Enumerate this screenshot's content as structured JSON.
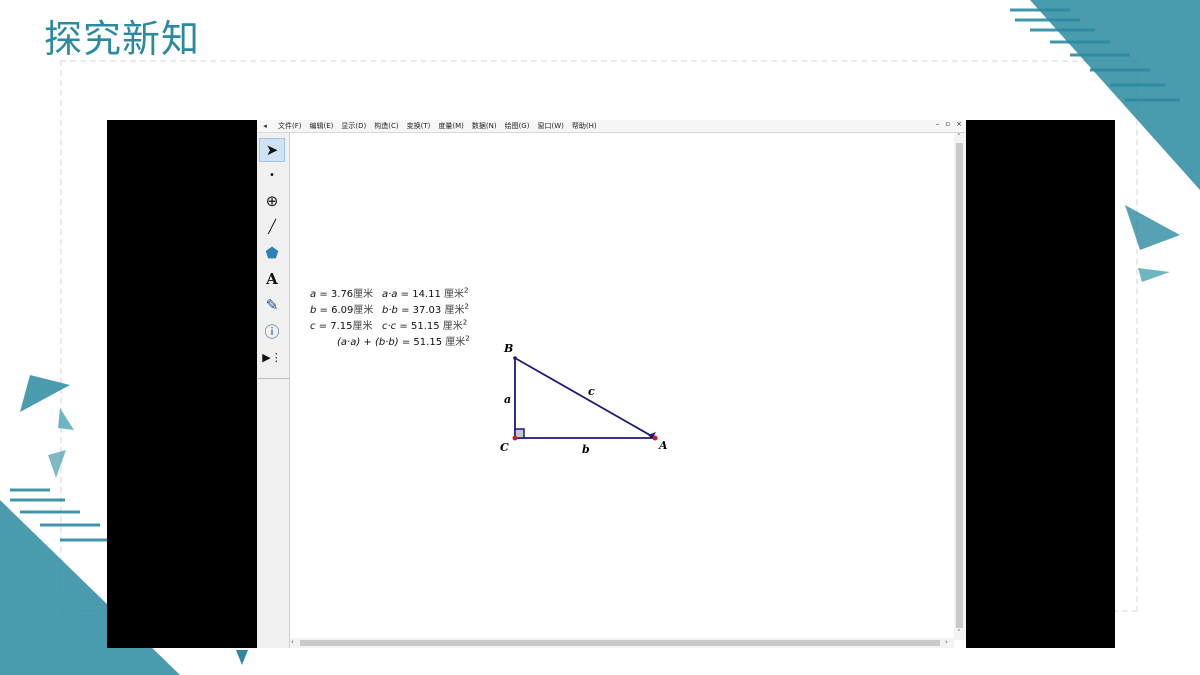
{
  "slide": {
    "title": "探究新知"
  },
  "colors": {
    "teal": "#2c8aa0",
    "teal_light": "#6fb5c4",
    "triangle_stroke": "#1a1a7a",
    "point_red": "#cc1f1f"
  },
  "app": {
    "menu": [
      "文件(F)",
      "编辑(E)",
      "显示(D)",
      "构造(C)",
      "变换(T)",
      "度量(M)",
      "数据(N)",
      "绘图(G)",
      "窗口(W)",
      "帮助(H)"
    ],
    "window_controls": [
      "–",
      "▫",
      "×"
    ],
    "tools": [
      {
        "name": "arrow-tool-icon",
        "glyph": "➤"
      },
      {
        "name": "point-tool-icon",
        "glyph": "•"
      },
      {
        "name": "compass-tool-icon",
        "glyph": "⊕"
      },
      {
        "name": "straightedge-tool-icon",
        "glyph": "╱"
      },
      {
        "name": "polygon-tool-icon",
        "glyph": "⬟"
      },
      {
        "name": "text-tool-icon",
        "glyph": "A"
      },
      {
        "name": "marker-tool-icon",
        "glyph": "✎"
      },
      {
        "name": "information-tool-icon",
        "glyph": "ⓘ"
      },
      {
        "name": "custom-tool-icon",
        "glyph": "▶⋮"
      }
    ]
  },
  "measurements": {
    "rows": [
      {
        "var": "a",
        "value": "3.76",
        "unit": "厘米",
        "sq_expr": "a·a",
        "sq_value": "14.11",
        "sq_unit": "厘米"
      },
      {
        "var": "b",
        "value": "6.09",
        "unit": "厘米",
        "sq_expr": "b·b",
        "sq_value": "37.03",
        "sq_unit": "厘米"
      },
      {
        "var": "c",
        "value": "7.15",
        "unit": "厘米",
        "sq_expr": "c·c",
        "sq_value": "51.15",
        "sq_unit": "厘米"
      }
    ],
    "sum": {
      "expr": "(a·a) + (b·b)",
      "value": "51.15",
      "unit": "厘米"
    },
    "superscript": "2",
    "equals": "="
  },
  "figure": {
    "vertices": [
      "B",
      "C",
      "A"
    ],
    "sides": [
      "a",
      "b",
      "c"
    ]
  }
}
